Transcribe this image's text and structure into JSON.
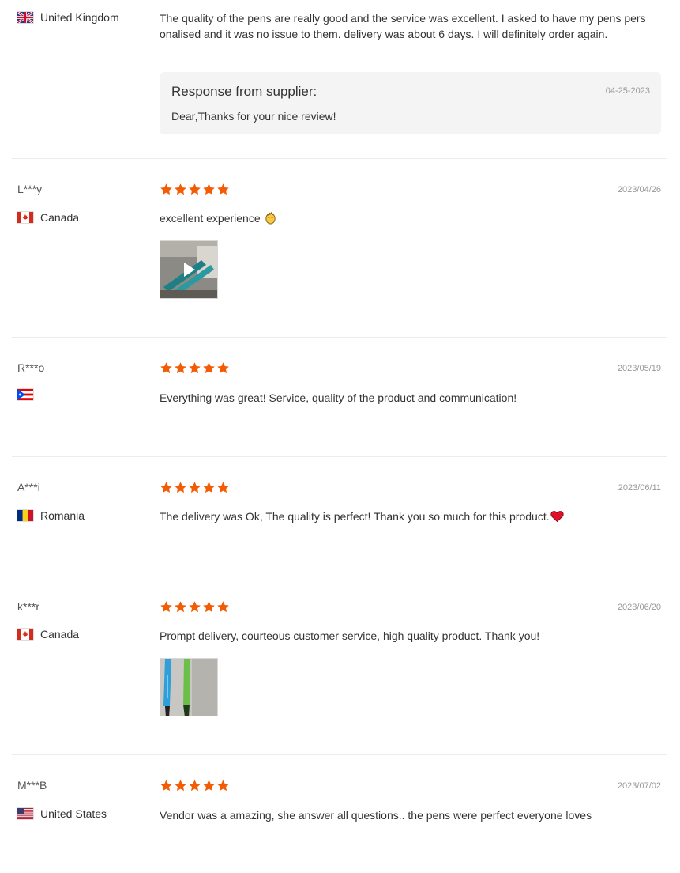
{
  "colors": {
    "star": "#f25c05",
    "divider": "#ececec",
    "supplier_bg": "#f4f4f4",
    "muted": "#999999"
  },
  "first_review": {
    "country": "United Kingdom",
    "text": "The quality of the pens are really good and the service was excellent. I asked to have my pens personalised and it was no issue to them. delivery was about 6 days. I will definitely order again.",
    "text_line1": "The quality of the pens are really good and the service was excellent. I asked to have my pens pers",
    "text_line2": "onalised and it was no issue to them. delivery was about 6 days. I will definitely order again.",
    "supplier_title": "Response from supplier:",
    "supplier_date": "04-25-2023",
    "supplier_message": "Dear,Thanks for your nice review!"
  },
  "reviews": [
    {
      "name": "L***y",
      "country": "Canada",
      "rating": 5,
      "date": "2023/04/26",
      "text": "excellent experience",
      "text_icon": "clapping-hands-icon",
      "media": "video-thumbnail"
    },
    {
      "name": "R***o",
      "country": "",
      "rating": 5,
      "date": "2023/05/19",
      "text": "Everything was great! Service, quality of the product and communication!",
      "flag_icon": "puerto-rico-flag-icon"
    },
    {
      "name": "A***i",
      "country": "Romania",
      "rating": 5,
      "date": "2023/06/11",
      "text": "The delivery was Ok, The quality is perfect! Thank you so much for this product.",
      "text_icon": "red-heart-icon"
    },
    {
      "name": "k***r",
      "country": "Canada",
      "rating": 5,
      "date": "2023/06/20",
      "text": "Prompt delivery, courteous customer service, high quality product. Thank you!",
      "media": "photo-thumbnail"
    },
    {
      "name": "M***B",
      "country": "United States",
      "rating": 5,
      "date": "2023/07/02",
      "text": "Vendor was a amazing, she answer all questions.. the pens were perfect everyone loves"
    }
  ]
}
